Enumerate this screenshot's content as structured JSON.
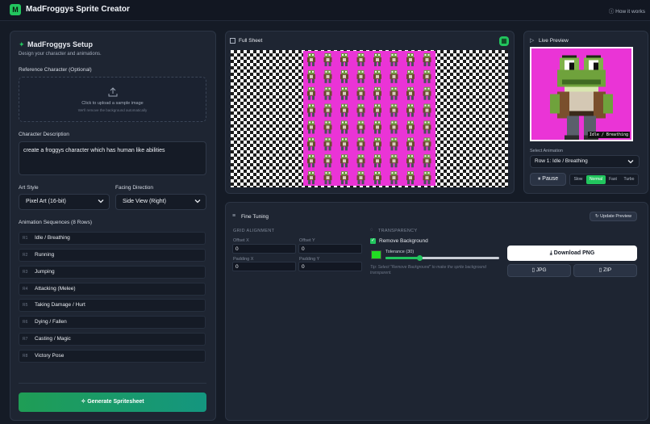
{
  "app": {
    "logo_letter": "M",
    "title": "MadFroggys Sprite Creator",
    "how_it_works": "How it works"
  },
  "setup": {
    "title": "MadFroggys Setup",
    "subtitle": "Design your character and animations.",
    "reference_label": "Reference Character (Optional)",
    "upload_text": "Click to upload a sample image",
    "upload_hint": "We'll remove the background automatically",
    "description_label": "Character Description",
    "description_value": "create a froggys character which has human like abilities",
    "art_style_label": "Art Style",
    "art_style_value": "Pixel Art (16-bit)",
    "facing_label": "Facing Direction",
    "facing_value": "Side View (Right)",
    "sequences_label": "Animation Sequences (8 Rows)",
    "sequences": [
      {
        "num": "R1",
        "label": "Idle / Breathing"
      },
      {
        "num": "R2",
        "label": "Running"
      },
      {
        "num": "R3",
        "label": "Jumping"
      },
      {
        "num": "R4",
        "label": "Attacking (Melee)"
      },
      {
        "num": "R5",
        "label": "Taking Damage / Hurt"
      },
      {
        "num": "R6",
        "label": "Dying / Fallen"
      },
      {
        "num": "R7",
        "label": "Casting / Magic"
      },
      {
        "num": "R8",
        "label": "Victory Pose"
      }
    ],
    "generate_label": "Generate Spritesheet"
  },
  "sheet": {
    "title": "Full Sheet"
  },
  "preview": {
    "title": "Live Preview",
    "overlay_text": "Idle / Breathing",
    "select_label": "Select Animation",
    "select_value": "Row 1: Idle / Breathing",
    "pause_label": "Pause",
    "speeds": [
      "Slow",
      "Normal",
      "Fast",
      "Turbo"
    ],
    "active_speed": "Normal"
  },
  "fine_tuning": {
    "title": "Fine Tuning",
    "update_label": "Update Preview",
    "grid_heading": "GRID ALIGNMENT",
    "offset_x_label": "Offset X",
    "offset_x": "0",
    "offset_y_label": "Offset Y",
    "offset_y": "0",
    "padding_x_label": "Padding X",
    "padding_x": "0",
    "padding_y_label": "Padding Y",
    "padding_y": "0",
    "transparency_heading": "TRANSPARENCY",
    "remove_bg_label": "Remove Background",
    "remove_bg_checked": true,
    "tolerance_label": "Tolerance (30)",
    "tolerance_value": 30,
    "tip_text": "Tip: Select \"Remove Background\" to make the sprite background transparent.",
    "download_png": "Download PNG",
    "jpg": "JPG",
    "zip": "ZIP"
  },
  "colors": {
    "accent": "#22c55e",
    "magenta": "#ea34d6",
    "panel": "#1e2532",
    "background": "#151b26"
  }
}
